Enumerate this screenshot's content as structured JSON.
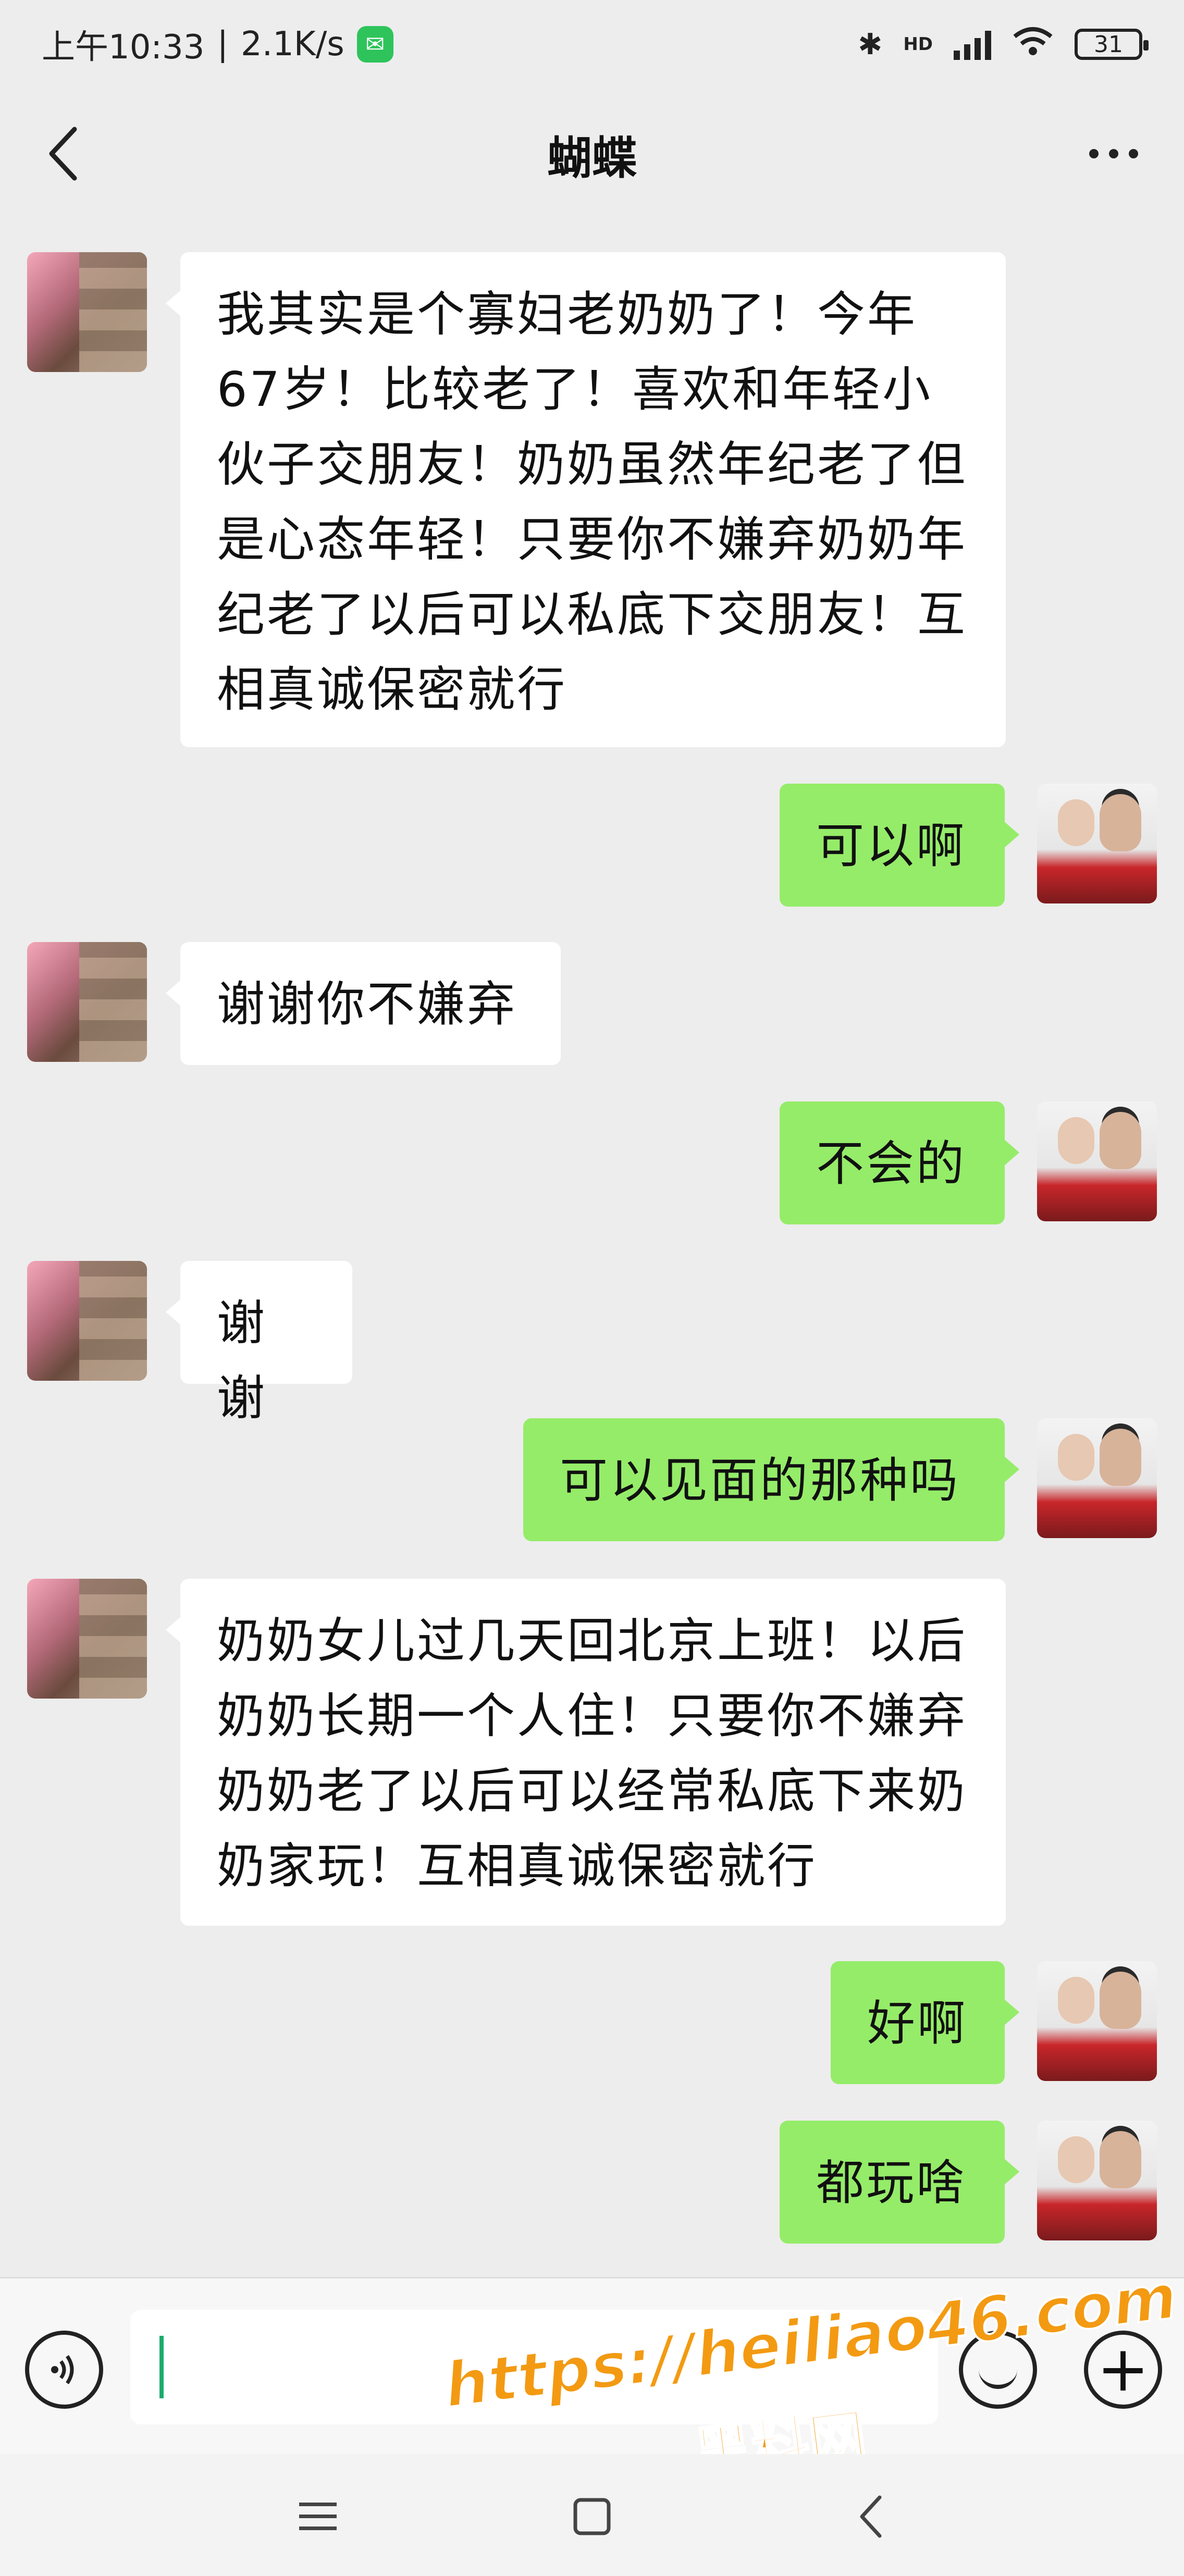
{
  "status_bar": {
    "time": "上午10:33",
    "speed": "2.1K/s",
    "separator": "|",
    "network": "HD",
    "battery": "31"
  },
  "header": {
    "title": "蝴蝶"
  },
  "messages": [
    {
      "side": "in",
      "text": "我其实是个寡妇老奶奶了！今年 67岁！比较老了！喜欢和年轻小伙子交朋友！奶奶虽然年纪老了但是心态年轻！只要你不嫌弃奶奶年纪老了以后可以私底下交朋友！互相真诚保密就行"
    },
    {
      "side": "out",
      "text": "可以啊"
    },
    {
      "side": "in",
      "text": "谢谢你不嫌弃"
    },
    {
      "side": "out",
      "text": "不会的"
    },
    {
      "side": "in",
      "text": "谢谢"
    },
    {
      "side": "out",
      "text": "可以见面的那种吗"
    },
    {
      "side": "in",
      "text": "奶奶女儿过几天回北京上班！以后奶奶长期一个人住！只要你不嫌弃奶奶老了以后可以经常私底下来奶奶家玩！互相真诚保密就行"
    },
    {
      "side": "out",
      "text": "好啊"
    },
    {
      "side": "out",
      "text": "都玩啥"
    }
  ],
  "watermark": {
    "url": "https://heiliao46.com",
    "name": "黑料网"
  },
  "colors": {
    "background": "#ededed",
    "bubble_out": "#95ec69",
    "bubble_in": "#ffffff",
    "watermark": "#f39a12"
  }
}
